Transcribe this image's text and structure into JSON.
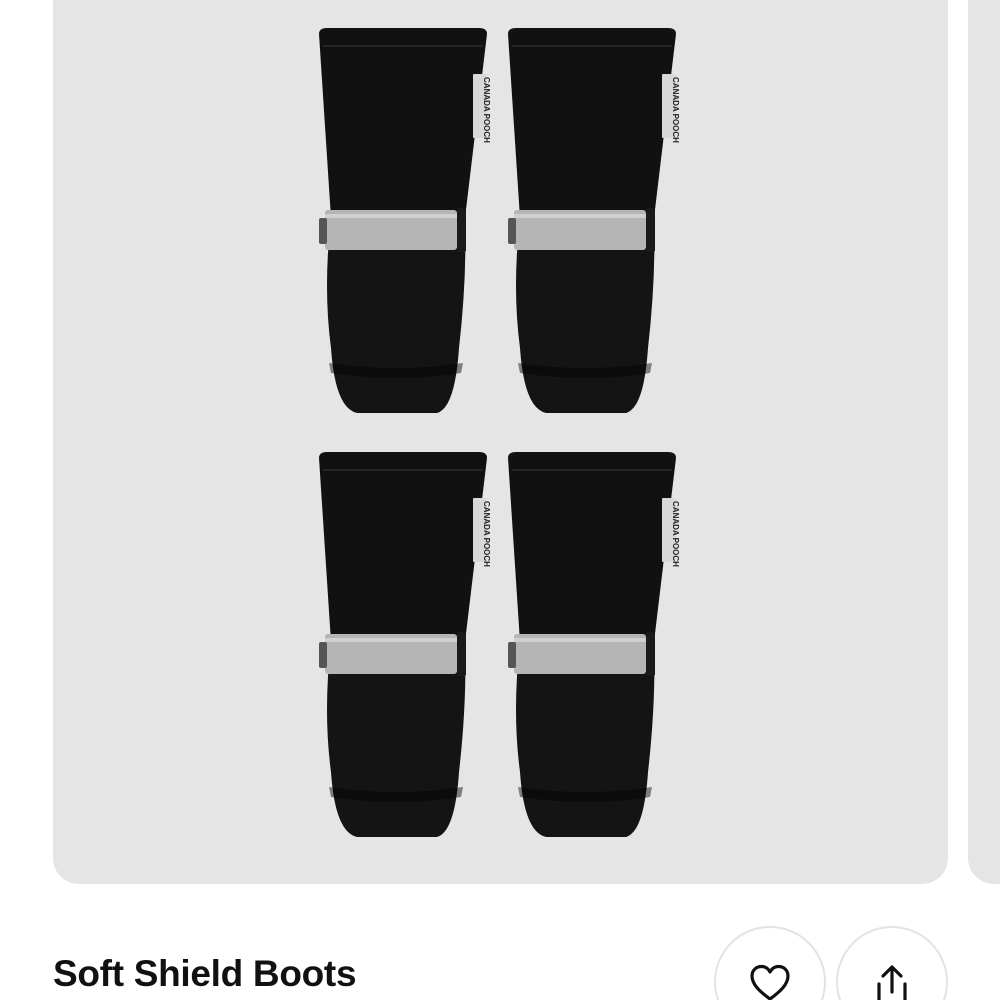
{
  "product": {
    "title": "Soft Shield Boots",
    "image_alt": "Four black dog boots with reflective straps",
    "tag_text": "CANADA POOCH"
  },
  "actions": {
    "wishlist_icon": "heart-icon",
    "share_icon": "share-icon"
  },
  "colors": {
    "image_bg": "#e5e5e5",
    "boot": "#111111",
    "strap": "#b5b5b5",
    "title": "#111111"
  }
}
